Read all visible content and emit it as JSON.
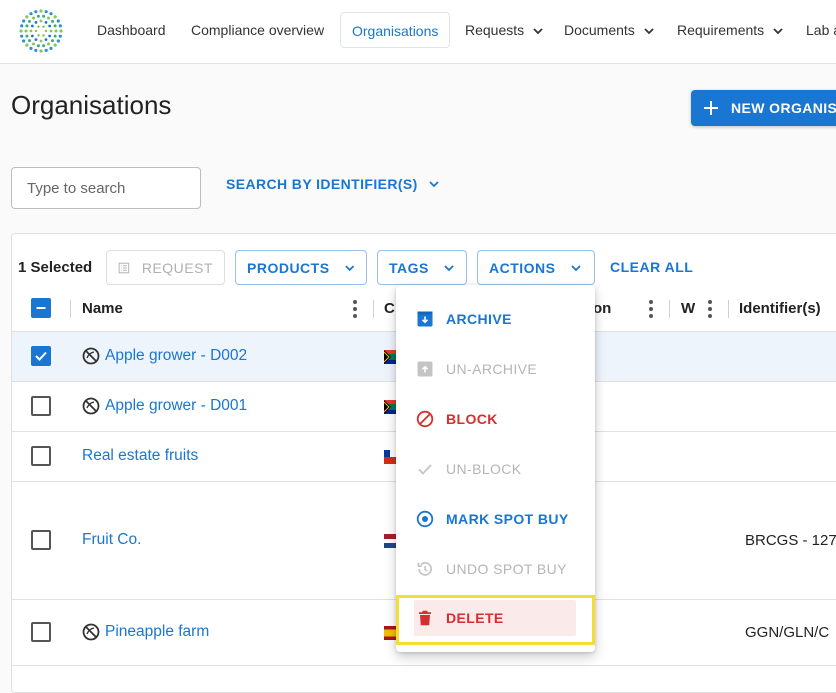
{
  "nav": {
    "items": [
      {
        "label": "Dashboard"
      },
      {
        "label": "Compliance overview"
      },
      {
        "label": "Organisations"
      },
      {
        "label": "Requests"
      },
      {
        "label": "Documents"
      },
      {
        "label": "Requirements"
      },
      {
        "label": "Lab a"
      }
    ]
  },
  "page": {
    "title": "Organisations",
    "new_button": "NEW ORGANIS"
  },
  "search": {
    "placeholder": "Type to search",
    "by_identifier": "SEARCH BY IDENTIFIER(S)"
  },
  "toolbar": {
    "selected": "1 Selected",
    "request": "REQUEST",
    "products": "PRODUCTS",
    "tags": "TAGS",
    "actions": "ACTIONS",
    "clear_all": "CLEAR ALL"
  },
  "table": {
    "headers": {
      "name": "Name",
      "country": "C",
      "location": "on",
      "w": "W",
      "identifiers": "Identifier(s)"
    },
    "rows": [
      {
        "name": "Apple grower - D002",
        "blocked": true,
        "checked": true,
        "identifier": ""
      },
      {
        "name": "Apple grower - D001",
        "blocked": true,
        "checked": false,
        "identifier": ""
      },
      {
        "name": "Real estate fruits",
        "blocked": false,
        "checked": false,
        "identifier": ""
      },
      {
        "name": "Fruit Co.",
        "blocked": false,
        "checked": false,
        "identifier": "BRCGS - 127"
      },
      {
        "name": "Pineapple farm",
        "blocked": true,
        "checked": false,
        "identifier": "GGN/GLN/C"
      }
    ]
  },
  "actions_menu": {
    "items": [
      {
        "label": "ARCHIVE",
        "icon": "archive-icon",
        "enabled": true
      },
      {
        "label": "UN-ARCHIVE",
        "icon": "unarchive-icon",
        "enabled": false
      },
      {
        "label": "BLOCK",
        "icon": "block-icon",
        "enabled": true
      },
      {
        "label": "UN-BLOCK",
        "icon": "check-icon",
        "enabled": false
      },
      {
        "label": "MARK SPOT BUY",
        "icon": "radio-target-icon",
        "enabled": true
      },
      {
        "label": "UNDO SPOT BUY",
        "icon": "history-icon",
        "enabled": false
      },
      {
        "label": "DELETE",
        "icon": "trash-icon",
        "enabled": true
      }
    ]
  },
  "colors": {
    "primary": "#1976d2",
    "danger": "#d32f2f",
    "disabled": "#b5b5b5",
    "highlight": "#f1e033"
  }
}
